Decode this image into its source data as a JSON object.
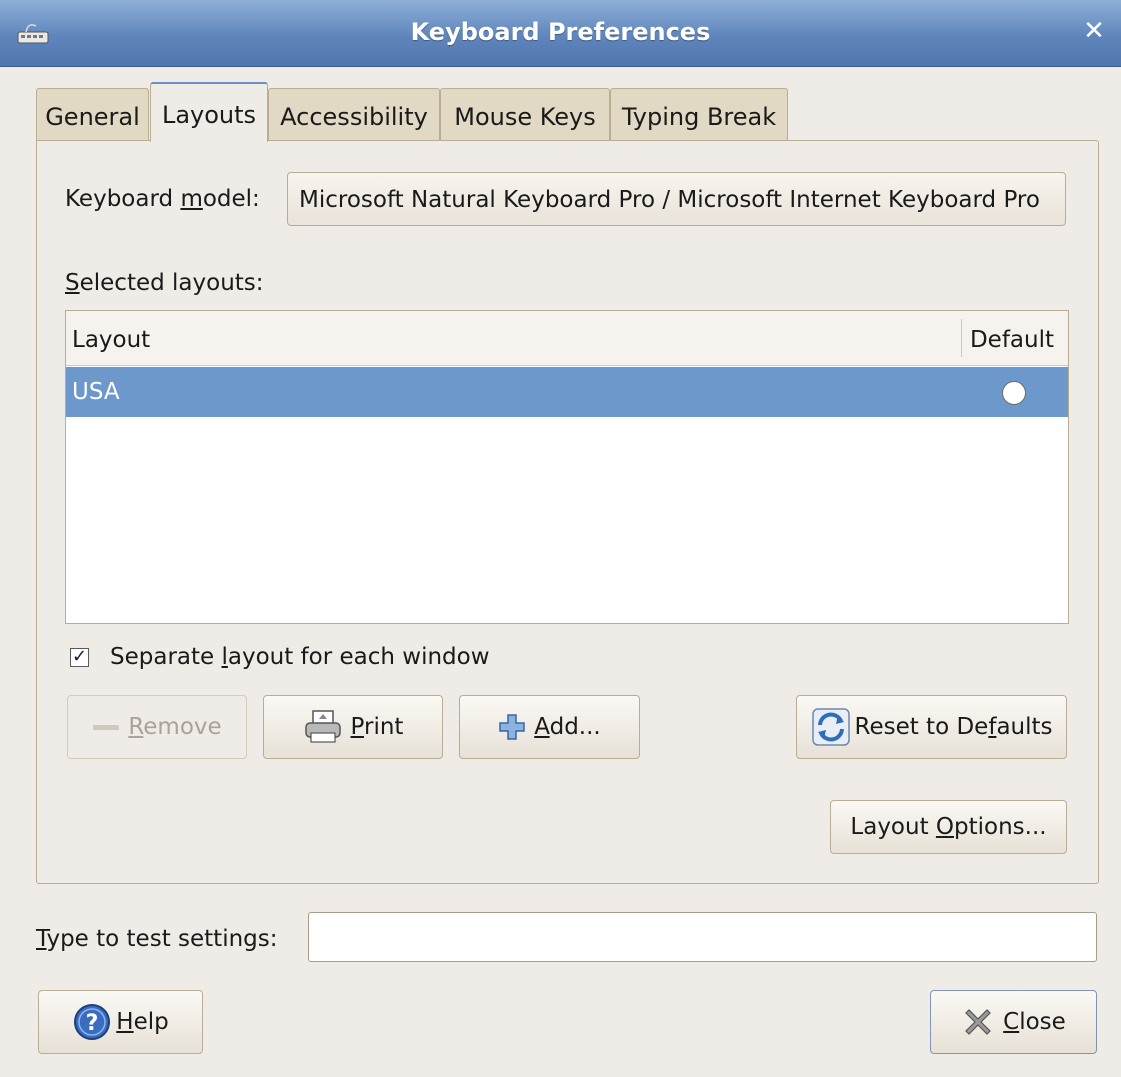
{
  "window": {
    "title": "Keyboard Preferences",
    "icon": "keyboard-icon",
    "close_icon": "close-icon"
  },
  "tabs": [
    {
      "label": "General",
      "active": false
    },
    {
      "label": "Layouts",
      "active": true
    },
    {
      "label": "Accessibility",
      "active": false
    },
    {
      "label": "Mouse Keys",
      "active": false
    },
    {
      "label": "Typing Break",
      "active": false
    }
  ],
  "layouts_tab": {
    "keyboard_model_label_pre": "Keyboard ",
    "keyboard_model_label_mnemonic": "m",
    "keyboard_model_label_post": "odel:",
    "keyboard_model_value": "Microsoft Natural Keyboard Pro / Microsoft Internet Keyboard Pro",
    "selected_layouts_mnemonic": "S",
    "selected_layouts_label_post": "elected layouts:",
    "table": {
      "columns": [
        "Layout",
        "Default"
      ],
      "rows": [
        {
          "layout": "USA",
          "default": false,
          "selected": true
        }
      ]
    },
    "separate_layout": {
      "label_pre": "Separate ",
      "mnemonic": "l",
      "label_post": "ayout for each window",
      "checked": true
    },
    "buttons": {
      "remove": {
        "mnemonic": "R",
        "label_post": "emove",
        "icon": "minus-icon",
        "enabled": false
      },
      "print": {
        "mnemonic": "P",
        "label_post": "rint",
        "icon": "printer-icon"
      },
      "add": {
        "mnemonic": "A",
        "label_post": "dd...",
        "icon": "plus-icon"
      },
      "reset": {
        "label_pre": "Reset to De",
        "mnemonic": "f",
        "label_post": "aults",
        "icon": "refresh-icon"
      },
      "layout_options": {
        "label_pre": "Layout ",
        "mnemonic": "O",
        "label_post": "ptions..."
      }
    }
  },
  "test_settings": {
    "mnemonic": "T",
    "label_post": "ype to test settings:",
    "value": ""
  },
  "footer": {
    "help": {
      "mnemonic": "H",
      "label_post": "elp",
      "icon": "help-icon"
    },
    "close": {
      "mnemonic": "C",
      "label_post": "lose",
      "icon": "close-x-icon"
    }
  },
  "colors": {
    "selection": "#6c98cb",
    "background": "#efebe7",
    "titlebar": "#5f86bc"
  }
}
